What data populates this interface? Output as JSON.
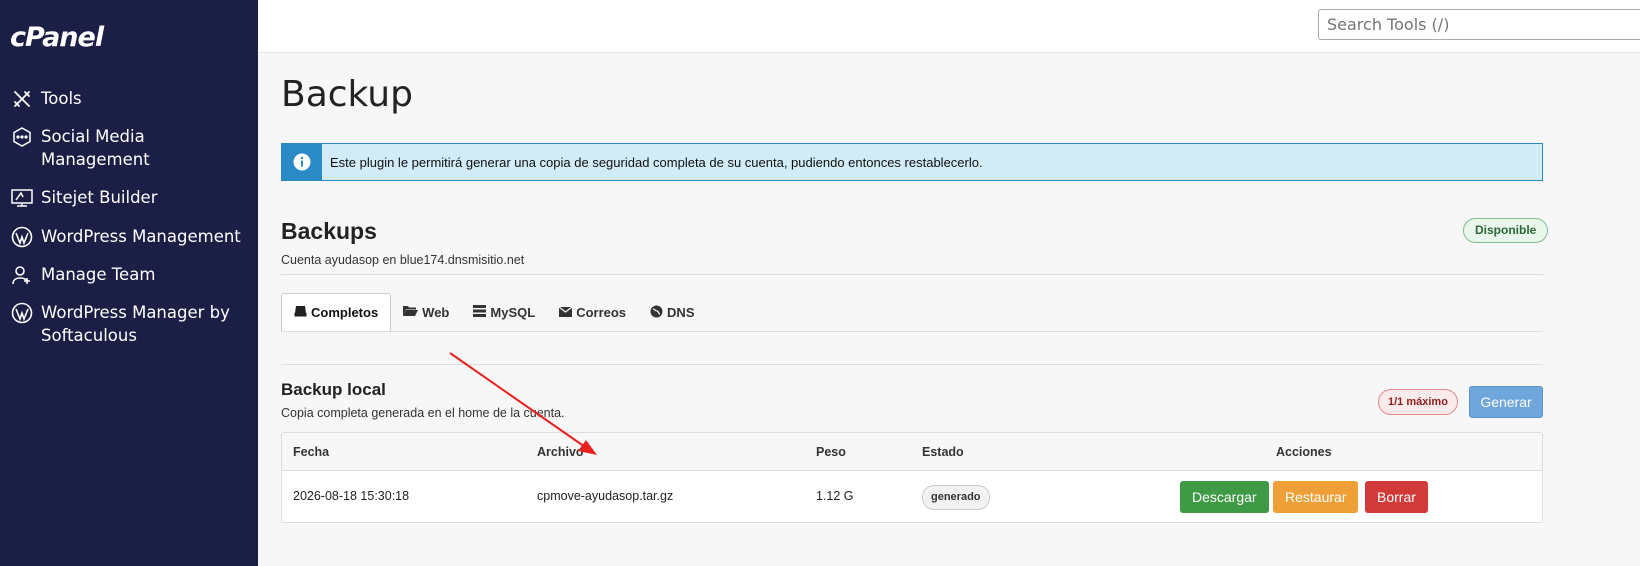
{
  "sidebar": {
    "logo": "cPanel",
    "items": [
      {
        "label": "Tools",
        "icon": "tools-icon"
      },
      {
        "label": "Social Media Management",
        "icon": "social-media-icon"
      },
      {
        "label": "Sitejet Builder",
        "icon": "sitejet-icon"
      },
      {
        "label": "WordPress Management",
        "icon": "wordpress-icon"
      },
      {
        "label": "Manage Team",
        "icon": "manage-team-icon"
      },
      {
        "label": "WordPress Manager by Softaculous",
        "icon": "wordpress-icon"
      }
    ]
  },
  "topbar": {
    "search_placeholder": "Search Tools (/)"
  },
  "page": {
    "title": "Backup",
    "alert": "Este plugin le permitirá generar una copia de seguridad completa de su cuenta, pudiendo entonces restablecerlo."
  },
  "backups": {
    "heading": "Backups",
    "account": "Cuenta ayudasop en blue174.dnsmisitio.net",
    "status": "Disponible"
  },
  "tabs": [
    {
      "label": "Completos",
      "icon": "drive-icon"
    },
    {
      "label": "Web",
      "icon": "folder-icon"
    },
    {
      "label": "MySQL",
      "icon": "server-icon"
    },
    {
      "label": "Correos",
      "icon": "envelope-icon"
    },
    {
      "label": "DNS",
      "icon": "globe-icon"
    }
  ],
  "local": {
    "heading": "Backup local",
    "description": "Copia completa generada en el home de la cuenta.",
    "limit": "1/1 máximo",
    "generate_label": "Generar"
  },
  "table": {
    "headers": {
      "fecha": "Fecha",
      "archivo": "Archivo",
      "peso": "Peso",
      "estado": "Estado",
      "acciones": "Acciones"
    },
    "rows": [
      {
        "fecha": "2026-08-18 15:30:18",
        "archivo": "cpmove-ayudasop.tar.gz",
        "peso": "1.12 G",
        "estado": "generado"
      }
    ],
    "actions": {
      "download": "Descargar",
      "restore": "Restaurar",
      "delete": "Borrar"
    }
  },
  "colors": {
    "sidebar_bg": "#1b1e45",
    "info": "#2a8ac6",
    "success": "#3e9a44",
    "warning": "#ee9f35",
    "danger": "#d23a3a",
    "primary": "#6fa6dc",
    "annotation_arrow": "#e8201e"
  }
}
